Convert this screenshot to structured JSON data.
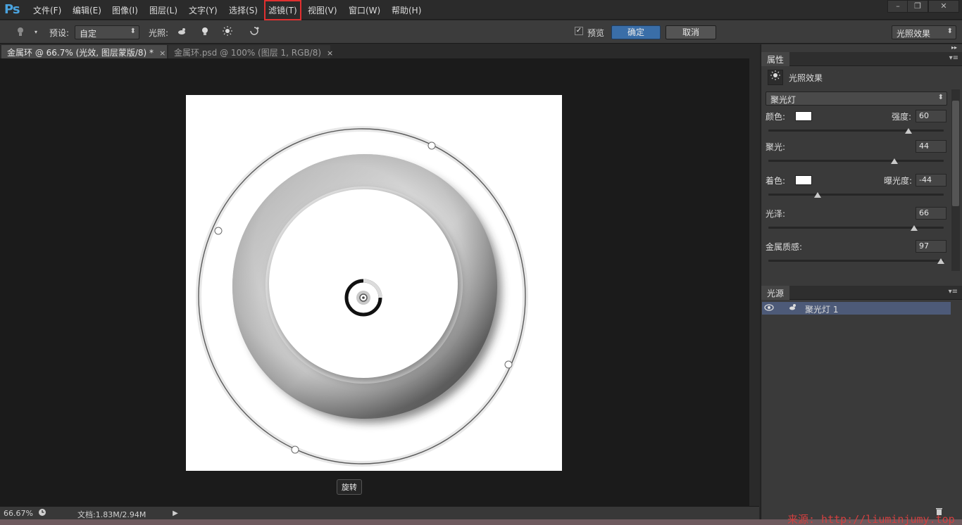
{
  "app": {
    "logo": "Ps"
  },
  "menu": [
    "文件(F)",
    "编辑(E)",
    "图像(I)",
    "图层(L)",
    "文字(Y)",
    "选择(S)",
    "滤镜(T)",
    "视图(V)",
    "窗口(W)",
    "帮助(H)"
  ],
  "window_controls": {
    "minimize": "–",
    "restore": "❐",
    "close": "✕"
  },
  "options": {
    "preset_label": "预设:",
    "preset_value": "自定",
    "light_label": "光照:",
    "preview_label": "预览",
    "preview_checked": "✓",
    "ok_label": "确定",
    "cancel_label": "取消",
    "workspace_value": "光照效果"
  },
  "tabs": [
    {
      "title": "金属环 @ 66.7% (光效, 图层蒙版/8) *",
      "close": "×"
    },
    {
      "title": "金属环.psd @ 100% (图层 1, RGB/8)",
      "close": "×"
    }
  ],
  "tooltip": "旋转",
  "status": {
    "zoom": "66.67%",
    "doc_info": "文档:1.83M/2.94M"
  },
  "properties": {
    "panel_title": "属性",
    "effect_title": "光照效果",
    "light_type": "聚光灯",
    "color_label": "颜色:",
    "intensity_label": "强度:",
    "intensity_value": "60",
    "intensity_pct": 0.8,
    "hotspot_label": "聚光:",
    "hotspot_value": "44",
    "hotspot_pct": 0.72,
    "colorize_label": "着色:",
    "exposure_label": "曝光度:",
    "exposure_value": "-44",
    "exposure_pct": 0.28,
    "gloss_label": "光泽:",
    "gloss_value": "66",
    "gloss_pct": 0.83,
    "metallic_label": "金属质感:",
    "metallic_value": "97",
    "metallic_pct": 0.985
  },
  "lights_panel": {
    "title": "光源",
    "item_label": "聚光灯 1"
  },
  "watermark": "来源: http://liuminjumy.top"
}
